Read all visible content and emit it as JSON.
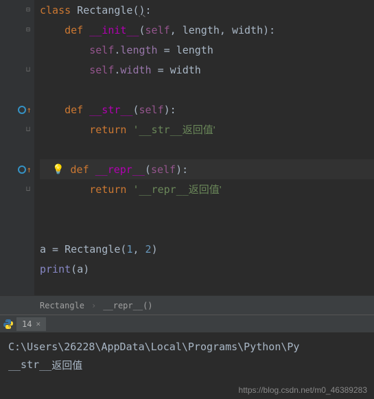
{
  "code": {
    "kw_class": "class",
    "class_name": "Rectangle",
    "kw_def": "def",
    "fn_init": "__init__",
    "fn_str": "__str__",
    "fn_repr": "__repr__",
    "kw_self": "self",
    "param_length": "length",
    "param_width": "width",
    "attr_length": "length",
    "attr_width": "width",
    "kw_return": "return",
    "str_str_ret_prefix": "'__str__",
    "str_str_ret_suffix": "返回值'",
    "str_repr_ret_prefix": "'__repr__",
    "str_repr_ret_suffix": "返回值'",
    "var_a": "a",
    "call_args_1": "1",
    "call_args_2": "2",
    "fn_print": "print"
  },
  "breadcrumb": {
    "item1": "Rectangle",
    "item2": "__repr__()"
  },
  "tab": {
    "label": "14"
  },
  "terminal": {
    "line1": "C:\\Users\\26228\\AppData\\Local\\Programs\\Python\\Py",
    "line2_prefix": "__str__",
    "line2_suffix": "返回值"
  },
  "watermark": "https://blog.csdn.net/m0_46389283"
}
